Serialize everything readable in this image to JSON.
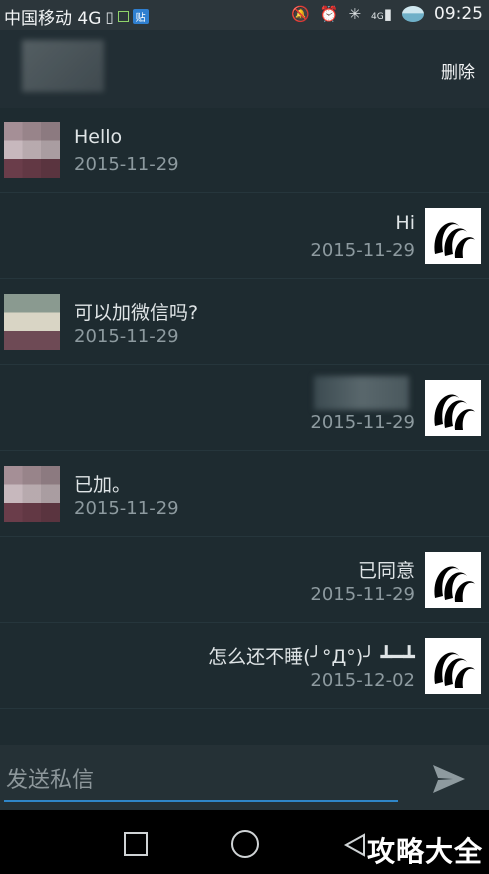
{
  "status_bar": {
    "carrier": "中国移动 4G",
    "chip_label": "贴",
    "time": "09:25",
    "signal_label": "4G",
    "icons": [
      "sim-icon",
      "mute-icon",
      "alarm-icon",
      "sync-icon",
      "signal-icon",
      "battery-icon"
    ]
  },
  "header": {
    "delete_label": "删除"
  },
  "messages": [
    {
      "side": "left",
      "text": "Hello",
      "date": "2015-11-29"
    },
    {
      "side": "right",
      "text": "Hi",
      "date": "2015-11-29"
    },
    {
      "side": "left",
      "text": "可以加微信吗?",
      "date": "2015-11-29"
    },
    {
      "side": "right",
      "text": "",
      "date": "2015-11-29"
    },
    {
      "side": "left",
      "text": "已加。",
      "date": "2015-11-29"
    },
    {
      "side": "right",
      "text": "已同意",
      "date": "2015-11-29"
    },
    {
      "side": "right",
      "text": "怎么还不睡(╯°Д°)╯ ┻━┻",
      "date": "2015-12-02"
    }
  ],
  "input": {
    "placeholder": "发送私信"
  },
  "watermark": "攻略大全",
  "colors": {
    "background": "#1e2b30",
    "accent": "#2f86c8"
  }
}
